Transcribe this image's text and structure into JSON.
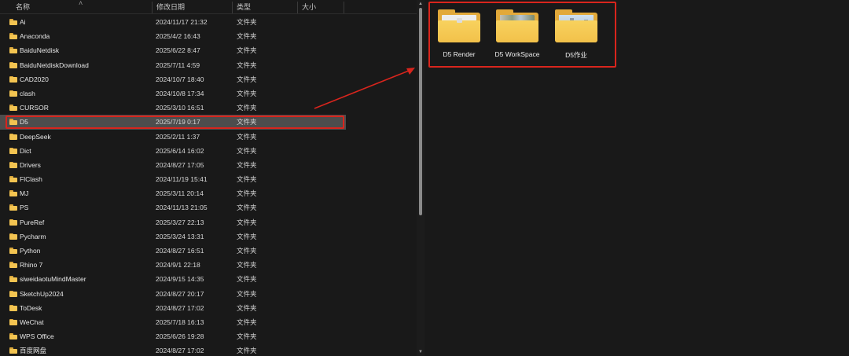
{
  "columns": {
    "name": "名称",
    "date": "修改日期",
    "type": "类型",
    "size": "大小"
  },
  "rows": [
    {
      "name": "Ai",
      "date": "2024/11/17 21:32",
      "type": "文件夹"
    },
    {
      "name": "Anaconda",
      "date": "2025/4/2 16:43",
      "type": "文件夹"
    },
    {
      "name": "BaiduNetdisk",
      "date": "2025/6/22 8:47",
      "type": "文件夹"
    },
    {
      "name": "BaiduNetdiskDownload",
      "date": "2025/7/11 4:59",
      "type": "文件夹"
    },
    {
      "name": "CAD2020",
      "date": "2024/10/7 18:40",
      "type": "文件夹"
    },
    {
      "name": "clash",
      "date": "2024/10/8 17:34",
      "type": "文件夹"
    },
    {
      "name": "CURSOR",
      "date": "2025/3/10 16:51",
      "type": "文件夹"
    },
    {
      "name": "D5",
      "date": "2025/7/19 0:17",
      "type": "文件夹",
      "selected": true
    },
    {
      "name": "DeepSeek",
      "date": "2025/2/11 1:37",
      "type": "文件夹"
    },
    {
      "name": "Dict",
      "date": "2025/6/14 16:02",
      "type": "文件夹"
    },
    {
      "name": "Drivers",
      "date": "2024/8/27 17:05",
      "type": "文件夹"
    },
    {
      "name": "FlClash",
      "date": "2024/11/19 15:41",
      "type": "文件夹"
    },
    {
      "name": "MJ",
      "date": "2025/3/11 20:14",
      "type": "文件夹"
    },
    {
      "name": "PS",
      "date": "2024/11/13 21:05",
      "type": "文件夹"
    },
    {
      "name": "PureRef",
      "date": "2025/3/27 22:13",
      "type": "文件夹"
    },
    {
      "name": "Pycharm",
      "date": "2025/3/24 13:31",
      "type": "文件夹"
    },
    {
      "name": "Python",
      "date": "2024/8/27 16:51",
      "type": "文件夹"
    },
    {
      "name": "Rhino 7",
      "date": "2024/9/1 22:18",
      "type": "文件夹"
    },
    {
      "name": "siweidaotuMindMaster",
      "date": "2024/9/15 14:35",
      "type": "文件夹"
    },
    {
      "name": "SketchUp2024",
      "date": "2024/8/27 20:17",
      "type": "文件夹"
    },
    {
      "name": "ToDesk",
      "date": "2024/8/27 17:02",
      "type": "文件夹"
    },
    {
      "name": "WeChat",
      "date": "2025/7/18 16:13",
      "type": "文件夹"
    },
    {
      "name": "WPS Office",
      "date": "2025/6/26 19:28",
      "type": "文件夹"
    },
    {
      "name": "百度网盘",
      "date": "2024/8/27 17:02",
      "type": "文件夹"
    }
  ],
  "subfolders": [
    {
      "name": "D5 Render"
    },
    {
      "name": "D5 WorkSpace"
    },
    {
      "name": "D5作业"
    }
  ],
  "icons": {
    "folder": "folder-icon",
    "sort": "chevron-up-icon",
    "scroll_up": "scroll-up-arrow-icon",
    "scroll_down": "scroll-down-arrow-icon"
  },
  "colors": {
    "background": "#191919",
    "selected_row": "#4d4d4d",
    "highlight": "#d9251d",
    "folder": "#f3c451"
  }
}
